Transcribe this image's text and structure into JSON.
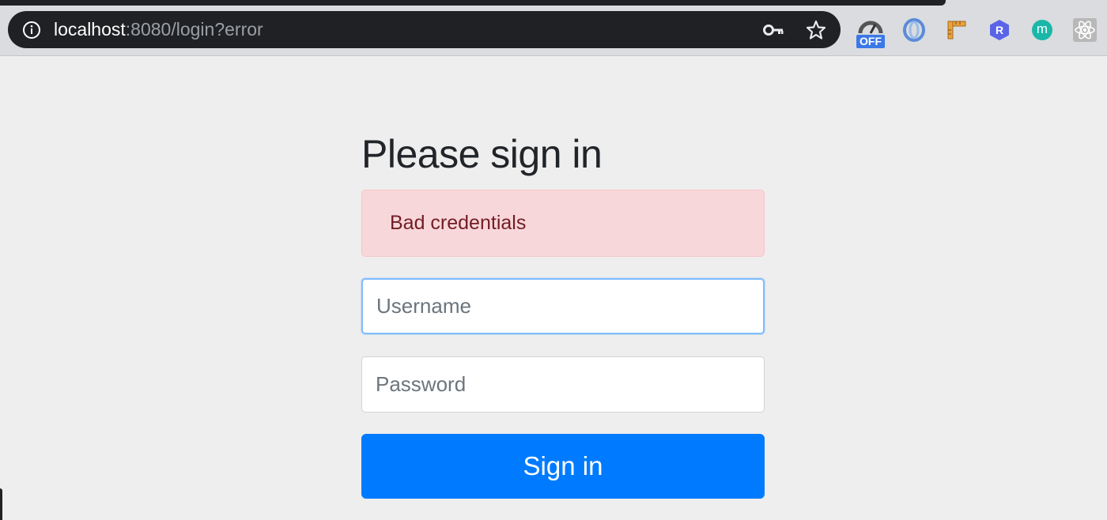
{
  "browser": {
    "url_host": "localhost",
    "url_rest": ":8080/login?error",
    "extensions": [
      {
        "name": "speedometer-extension",
        "badge": "OFF"
      },
      {
        "name": "swirl-extension"
      },
      {
        "name": "ruler-extension"
      },
      {
        "name": "r-extension",
        "letter": "R"
      },
      {
        "name": "m-extension",
        "letter": "m"
      },
      {
        "name": "react-extension"
      }
    ]
  },
  "login": {
    "title": "Please sign in",
    "error_message": "Bad credentials",
    "username_placeholder": "Username",
    "password_placeholder": "Password",
    "submit_label": "Sign in"
  },
  "colors": {
    "primary": "#007bff",
    "alert_bg": "#f8d7da",
    "alert_text": "#721c24",
    "page_bg": "#eeeeee"
  }
}
